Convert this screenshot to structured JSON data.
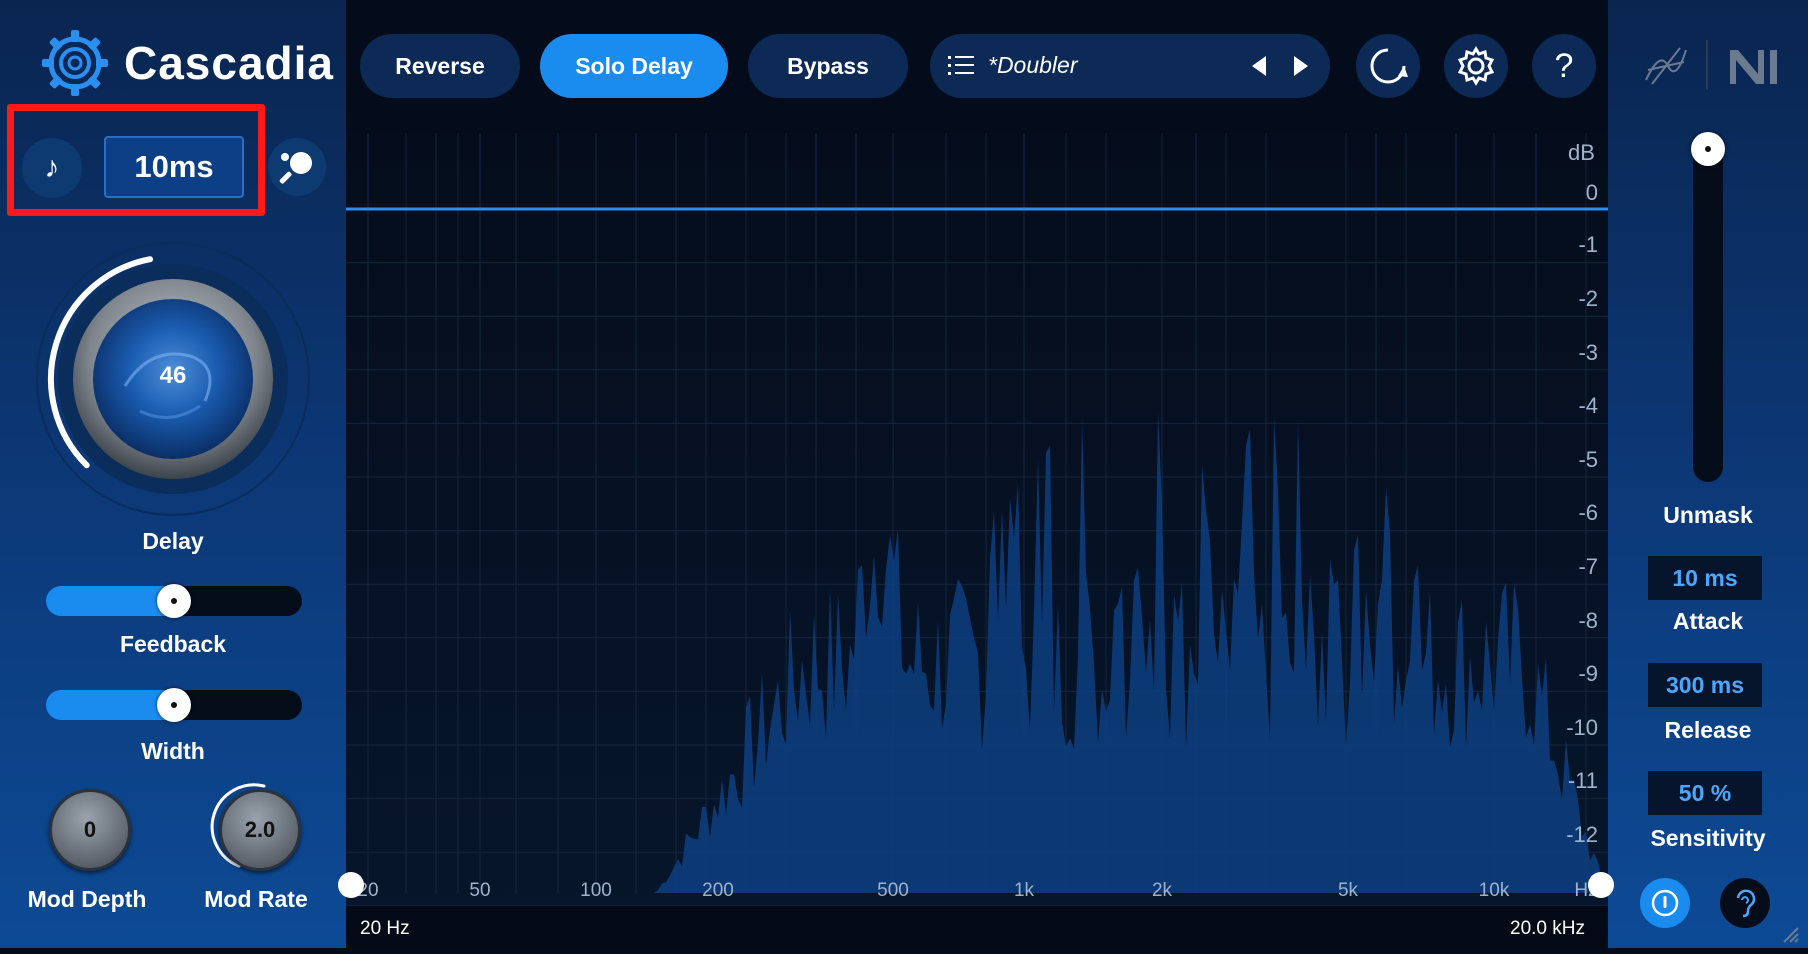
{
  "app": {
    "title": "Cascadia"
  },
  "header": {
    "reverse_label": "Reverse",
    "solo_delay_label": "Solo Delay",
    "bypass_label": "Bypass",
    "preset_name": "*Doubler"
  },
  "delay": {
    "time_value": "10ms",
    "knob_value": "46",
    "knob_label": "Delay",
    "knob_level": 0.46
  },
  "feedback": {
    "label": "Feedback",
    "level": 0.5
  },
  "width": {
    "label": "Width",
    "level": 0.5
  },
  "mod_depth": {
    "label": "Mod Depth",
    "value": "0"
  },
  "mod_rate": {
    "label": "Mod Rate",
    "value": "2.0"
  },
  "spectrum": {
    "db_unit": "dB",
    "db_labels": [
      "0",
      "-1",
      "-2",
      "-3",
      "-4",
      "-5",
      "-6",
      "-7",
      "-8",
      "-9",
      "-10",
      "-11",
      "-12"
    ],
    "freq_labels": [
      "20",
      "50",
      "100",
      "200",
      "500",
      "1k",
      "2k",
      "5k",
      "10k",
      "Hz"
    ],
    "range_low": "20 Hz",
    "range_high": "20.0 kHz"
  },
  "unmask": {
    "label": "Unmask",
    "level": 1.0,
    "attack_value": "10 ms",
    "attack_label": "Attack",
    "release_value": "300 ms",
    "release_label": "Release",
    "sensitivity_value": "50 %",
    "sensitivity_label": "Sensitivity"
  },
  "colors": {
    "accent": "#1a8cf0",
    "highlight_box": "#ff1a1a",
    "panel": "#0c3a7a",
    "spectrum_fill": "#0d3f80",
    "value_text": "#4aa8ff"
  },
  "icons": {
    "logo": "cascadia-gear-logo-icon",
    "note": "music-note-icon",
    "ping_pong": "ping-pong-icon",
    "list": "list-icon",
    "prev": "triangle-left-icon",
    "next": "triangle-right-icon",
    "loop": "loop-icon",
    "settings": "gear-icon",
    "help": "question-icon",
    "brand_izotope": "izotope-logo-icon",
    "brand_ni": "ni-logo-icon",
    "power": "power-icon",
    "listen": "ear-icon",
    "resize": "resize-grip-icon"
  }
}
